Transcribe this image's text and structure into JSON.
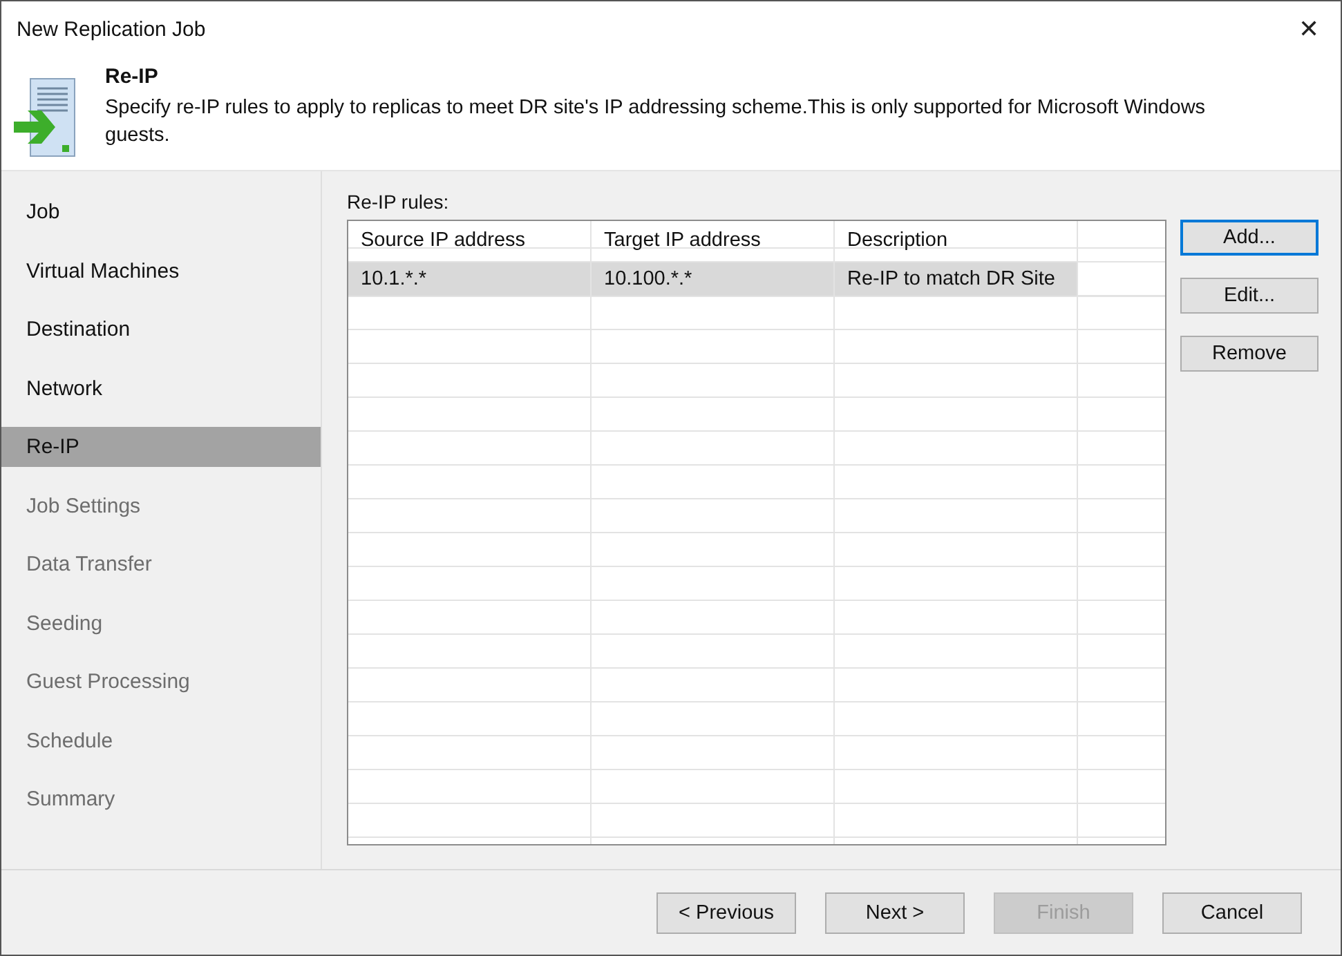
{
  "window": {
    "title": "New Replication Job",
    "close": "✕"
  },
  "header": {
    "title": "Re-IP",
    "description": "Specify re-IP rules to apply to replicas to meet DR site's IP addressing scheme.This is only supported for Microsoft Windows guests."
  },
  "sidebar": {
    "items": [
      {
        "label": "Job",
        "selected": false,
        "disabled": false
      },
      {
        "label": "Virtual Machines",
        "selected": false,
        "disabled": false
      },
      {
        "label": "Destination",
        "selected": false,
        "disabled": false
      },
      {
        "label": "Network",
        "selected": false,
        "disabled": false
      },
      {
        "label": "Re-IP",
        "selected": true,
        "disabled": false
      },
      {
        "label": "Job Settings",
        "selected": false,
        "disabled": true
      },
      {
        "label": "Data Transfer",
        "selected": false,
        "disabled": true
      },
      {
        "label": "Seeding",
        "selected": false,
        "disabled": true
      },
      {
        "label": "Guest Processing",
        "selected": false,
        "disabled": true
      },
      {
        "label": "Schedule",
        "selected": false,
        "disabled": true
      },
      {
        "label": "Summary",
        "selected": false,
        "disabled": true
      }
    ]
  },
  "rules": {
    "label": "Re-IP rules:",
    "columns": [
      "Source IP address",
      "Target IP address",
      "Description"
    ],
    "rows": [
      {
        "cells": [
          "10.1.*.*",
          "10.100.*.*",
          "Re-IP to match DR Site"
        ],
        "selected": true
      }
    ]
  },
  "side_buttons": [
    {
      "label": "Add...",
      "focused": true
    },
    {
      "label": "Edit...",
      "focused": false
    },
    {
      "label": "Remove",
      "focused": false
    }
  ],
  "footer_buttons": [
    {
      "label": "< Previous",
      "disabled": false
    },
    {
      "label": "Next >",
      "disabled": false
    },
    {
      "label": "Finish",
      "disabled": true
    },
    {
      "label": "Cancel",
      "disabled": false
    }
  ]
}
